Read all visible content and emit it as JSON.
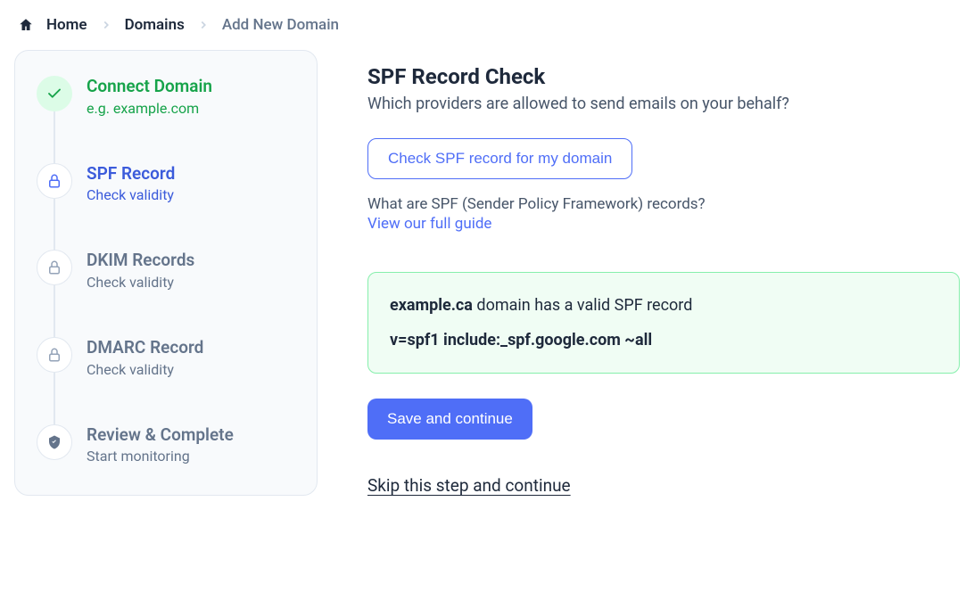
{
  "breadcrumb": {
    "home": "Home",
    "domains": "Domains",
    "current": "Add New Domain"
  },
  "stepper": {
    "steps": [
      {
        "title": "Connect Domain",
        "sub": "e.g. example.com",
        "state": "done",
        "icon": "check"
      },
      {
        "title": "SPF Record",
        "sub": "Check validity",
        "state": "active",
        "icon": "lock"
      },
      {
        "title": "DKIM Records",
        "sub": "Check validity",
        "state": "pending",
        "icon": "lock"
      },
      {
        "title": "DMARC Record",
        "sub": "Check validity",
        "state": "pending",
        "icon": "lock"
      },
      {
        "title": "Review & Complete",
        "sub": "Start monitoring",
        "state": "pending",
        "icon": "shield"
      }
    ]
  },
  "main": {
    "title": "SPF Record Check",
    "subtitle": "Which providers are allowed to send emails on your behalf?",
    "check_button": "Check SPF record for my domain",
    "helper_text": "What are SPF (Sender Policy Framework) records?",
    "guide_link": "View our full guide",
    "result": {
      "domain": "example.ca",
      "message_suffix": " domain has a valid SPF record",
      "record": "v=spf1 include:_spf.google.com ~all"
    },
    "save_button": "Save and continue",
    "skip_link": "Skip this step and continue"
  },
  "colors": {
    "primary": "#4f6ef7",
    "success": "#16a34a",
    "success_bg": "#f0fdf4",
    "success_border": "#86efac",
    "text": "#1e293b",
    "muted": "#64748b"
  }
}
